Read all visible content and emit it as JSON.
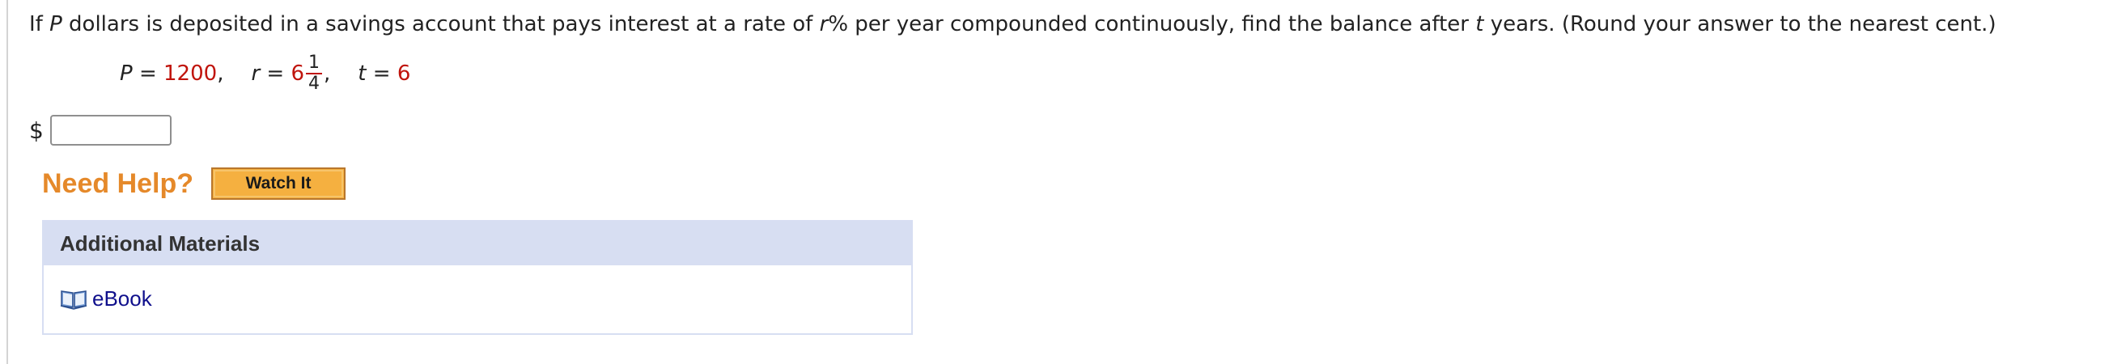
{
  "question": {
    "part1": "If ",
    "var_p": "P",
    "part2": " dollars is deposited in a savings account that pays interest at a rate of ",
    "var_r": "r",
    "part3": "% per year compounded continuously, find the balance after ",
    "var_t": "t",
    "part4": " years. (Round your answer to the nearest cent.)"
  },
  "params": {
    "p_label": "P",
    "eq": " = ",
    "p_value": "1200",
    "sep": ",",
    "r_label": "r",
    "r_whole": "6",
    "r_num": "1",
    "r_den": "4",
    "t_label": "t",
    "t_value": "6"
  },
  "answer": {
    "currency": "$",
    "value": ""
  },
  "help": {
    "label": "Need Help?",
    "watch_button": "Watch It"
  },
  "materials": {
    "header": "Additional Materials",
    "link": "eBook",
    "link_icon": "book-icon"
  },
  "colors": {
    "accent_red": "#c0140c",
    "help_orange": "#e5892a",
    "button_orange": "#f5b040",
    "panel_blue": "#d7def2",
    "link_blue": "#10108c"
  }
}
